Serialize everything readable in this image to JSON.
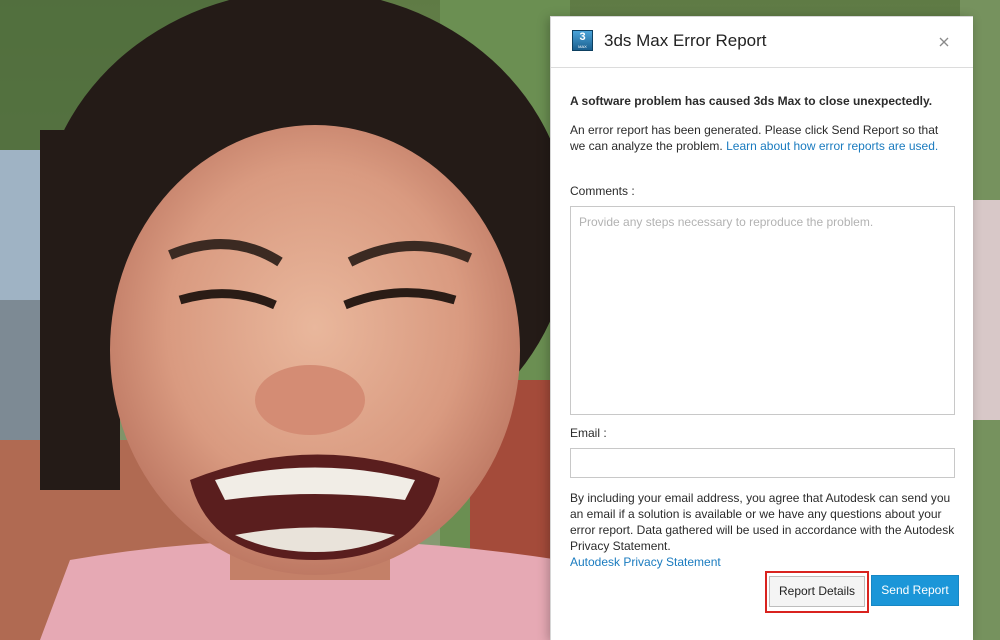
{
  "dialog": {
    "app_icon": {
      "number": "3",
      "sub_text": "MAX"
    },
    "title": "3ds Max Error Report",
    "close_icon": "close-icon",
    "headline": "A software problem has caused 3ds Max to close unexpectedly.",
    "description": "An error report has been generated. Please click Send Report so that we can analyze the problem.",
    "learn_link": "Learn about how error reports are used.",
    "comments_label": "Comments :",
    "comments_placeholder": "Provide any steps necessary to reproduce the problem.",
    "comments_value": "",
    "email_label": "Email :",
    "email_value": "",
    "consent_text": "By including your email address, you agree that Autodesk can send you an email if a solution is available or we have any questions about your error report. Data gathered will be used in accordance with the Autodesk Privacy Statement.",
    "privacy_link": "Autodesk Privacy Statement",
    "buttons": {
      "details": "Report Details",
      "send": "Send Report"
    }
  },
  "colors": {
    "link": "#1a7bbf",
    "primary_button": "#1b96d8",
    "highlight_box": "#d9231f"
  }
}
